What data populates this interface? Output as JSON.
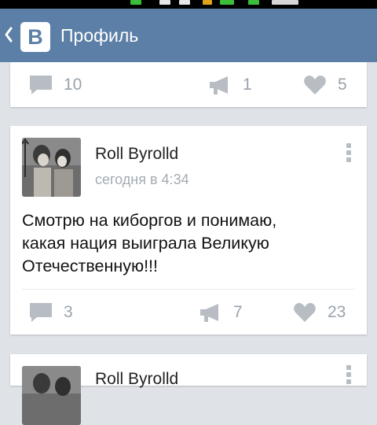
{
  "header": {
    "title": "Профиль",
    "logo_letter": "B"
  },
  "posts": [
    {
      "comments": "10",
      "reposts": "1",
      "likes": "5"
    },
    {
      "author": "Roll Byrolld",
      "time": "сегодня в 4:34",
      "text_lines": [
        "Смотрю на киборгов и понимаю,",
        "какая нация выиграла Великую",
        "Отечественную!!!"
      ],
      "comments": "3",
      "reposts": "7",
      "likes": "23"
    },
    {
      "author": "Roll Byrolld"
    }
  ],
  "colors": {
    "accent": "#5b7fa6",
    "background": "#dfe3e8",
    "icon_gray": "#b7bdc3"
  }
}
